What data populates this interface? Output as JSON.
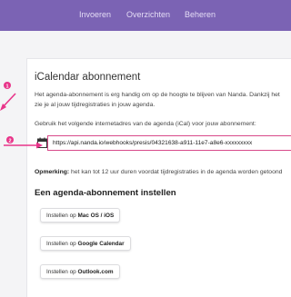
{
  "nav": {
    "links": [
      "Invoeren",
      "Overzichten",
      "Beheren"
    ],
    "bg_color": "#7b63b4"
  },
  "section": {
    "title": "iCalendar abonnement",
    "intro_line1": "Het agenda-abonnement is erg handig om op de hoogte te blijven van Nanda. Dankzij het",
    "intro_line2": "zie je al jouw tijdregistraties in jouw agenda.",
    "url_instruction": "Gebruik het volgende internetadres van de agenda (iCal) voor jouw abonnement:",
    "url_value": "https://api.nanda.io/webhooks/presis/04321638-a911-11e7-a8e6-xxxxxxxxx",
    "note_label": "Opmerking:",
    "note_text": " het kan tot 12 uur duren voordat tijdregistraties in de agenda worden getoond",
    "setup_heading": "Een agenda-abonnement instellen",
    "buttons": [
      {
        "prefix": "Instellen op ",
        "bold": "Mac OS / iOS"
      },
      {
        "prefix": "Instellen op ",
        "bold": "Google Calendar"
      },
      {
        "prefix": "Instellen op ",
        "bold": "Outlook.com"
      }
    ]
  },
  "annotations": {
    "markers": [
      "1",
      "2"
    ],
    "accent_color": "#e8358a"
  }
}
